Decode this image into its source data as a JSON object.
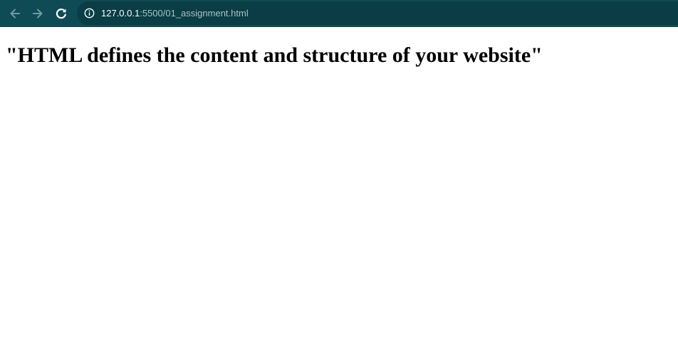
{
  "browser": {
    "url_host": "127.0.0.1",
    "url_path": ":5500/01_assignment.html",
    "colors": {
      "toolbar": "#0f4b55",
      "omnibox": "#0a3d45",
      "nav_disabled": "#6f9aa1",
      "nav_enabled": "#ffffff"
    },
    "icons": {
      "back": "arrow-left-icon",
      "forward": "arrow-right-icon",
      "reload": "reload-icon",
      "site_info": "info-icon"
    }
  },
  "page": {
    "heading": "\"HTML defines the content and structure of your website\""
  }
}
